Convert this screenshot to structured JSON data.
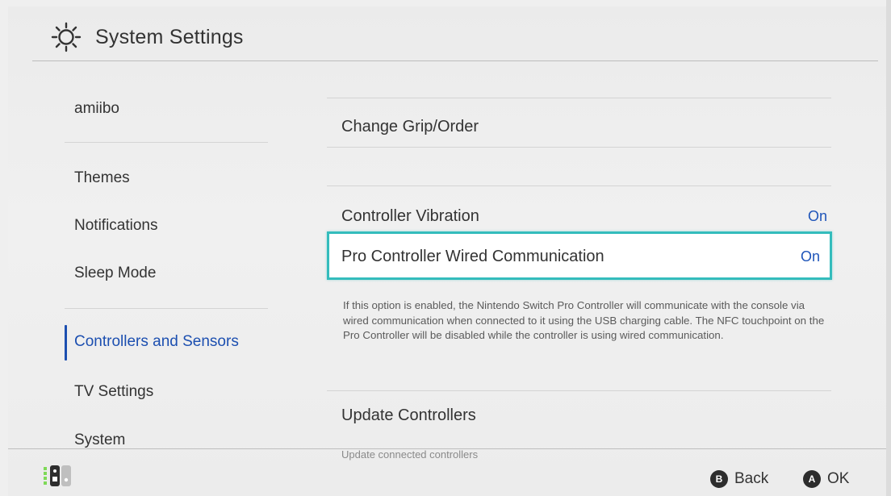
{
  "header": {
    "title": "System Settings",
    "icon": "gear-icon"
  },
  "sidebar": {
    "items": [
      {
        "label": "amiibo"
      },
      {
        "label": "Themes"
      },
      {
        "label": "Notifications"
      },
      {
        "label": "Sleep Mode"
      },
      {
        "label": "Controllers and Sensors",
        "selected": true
      },
      {
        "label": "TV Settings"
      },
      {
        "label": "System"
      }
    ]
  },
  "main": {
    "rows": [
      {
        "label": "Change Grip/Order",
        "value": ""
      },
      {
        "label": "Controller Vibration",
        "value": "On"
      },
      {
        "label": "Pro Controller Wired Communication",
        "value": "On",
        "focused": true,
        "description": "If this option is enabled, the Nintendo Switch Pro Controller will communicate with the console via wired communication when connected to it using the USB charging cable. The NFC touchpoint on the Pro Controller will be disabled while the controller is using wired communication."
      },
      {
        "label": "Update Controllers",
        "value": "",
        "subtext": "Update connected controllers"
      }
    ]
  },
  "footer": {
    "controller_icon": "joycon-icon",
    "hints": [
      {
        "button": "B",
        "label": "Back"
      },
      {
        "button": "A",
        "label": "OK"
      }
    ]
  },
  "colors": {
    "accent": "#1f55b9",
    "focus": "#34bcbc",
    "joycon_green": "#7ed957"
  }
}
